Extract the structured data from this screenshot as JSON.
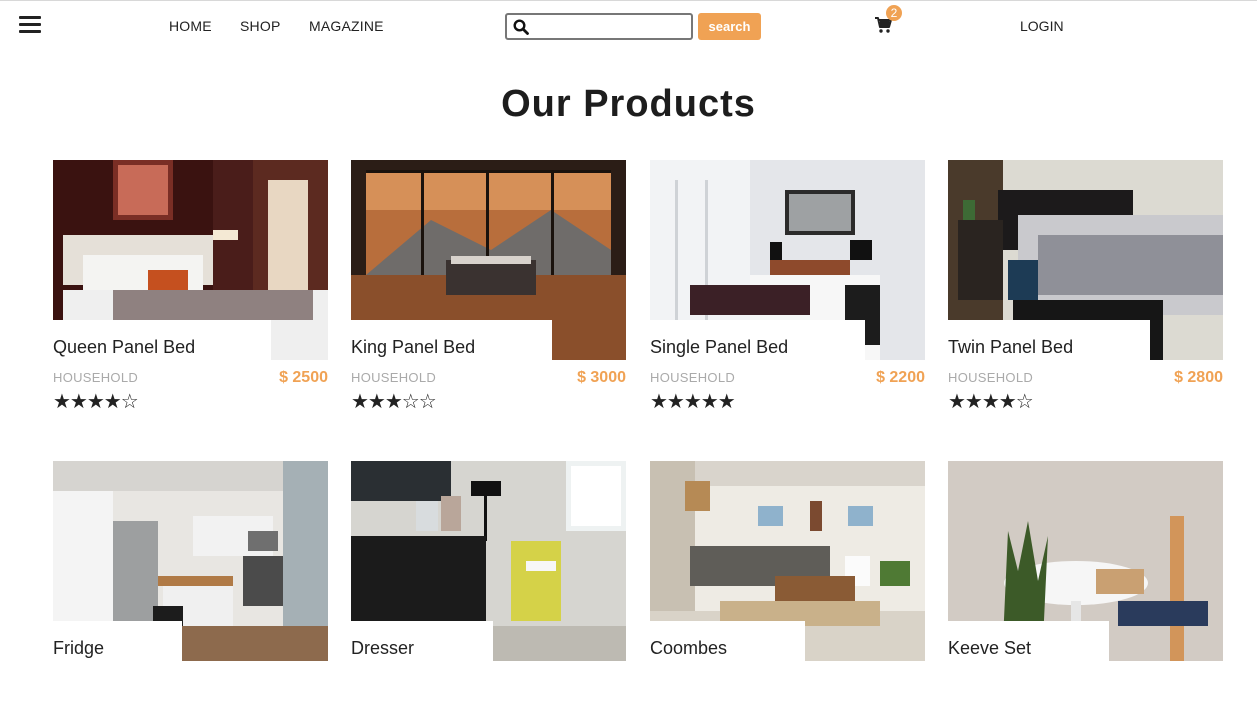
{
  "nav": {
    "links": [
      "HOME",
      "SHOP",
      "MAGAZINE"
    ],
    "search_placeholder": "",
    "search_button": "search",
    "cart_count": "2",
    "login": "LOGIN"
  },
  "heading": "Our Products",
  "colors": {
    "accent": "#f0a254",
    "text": "#222222",
    "muted": "#aaaaaa"
  },
  "products": [
    {
      "title": "Queen Panel Bed",
      "category": "HOUSEHOLD",
      "price": "$ 2500",
      "rating": 4,
      "stars": "★★★★☆"
    },
    {
      "title": "King Panel Bed",
      "category": "HOUSEHOLD",
      "price": "$ 3000",
      "rating": 3,
      "stars": "★★★☆☆"
    },
    {
      "title": "Single Panel Bed",
      "category": "HOUSEHOLD",
      "price": "$ 2200",
      "rating": 5,
      "stars": "★★★★★"
    },
    {
      "title": "Twin Panel Bed",
      "category": "HOUSEHOLD",
      "price": "$ 2800",
      "rating": 4,
      "stars": "★★★★☆"
    },
    {
      "title": "Fridge"
    },
    {
      "title": "Dresser"
    },
    {
      "title": "Coombes"
    },
    {
      "title": "Keeve Set"
    }
  ]
}
